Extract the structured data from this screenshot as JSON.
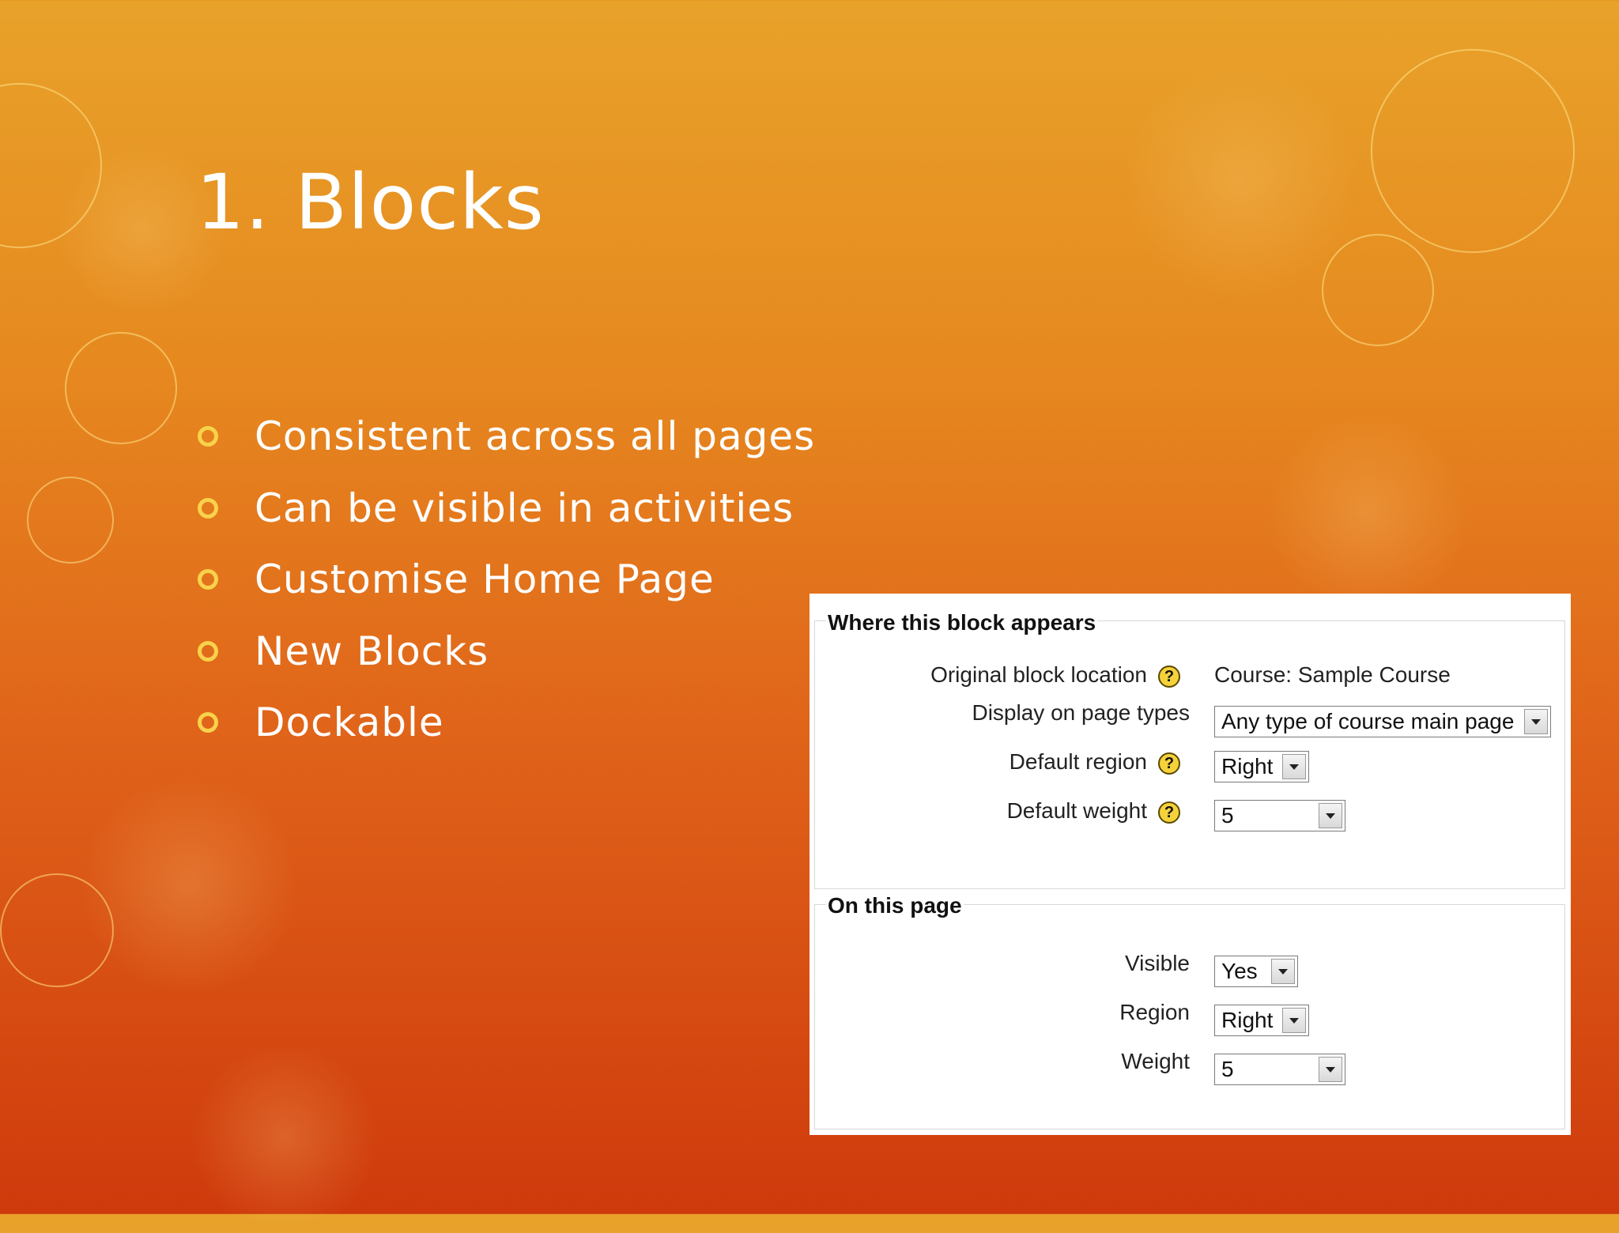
{
  "slide": {
    "title": "1. Blocks",
    "bullets": [
      "Consistent across all pages",
      "Can be visible in activities",
      "Customise Home Page",
      "New Blocks",
      "Dockable"
    ]
  },
  "panel": {
    "section1": {
      "legend": "Where this block appears",
      "original_location_label": "Original block location",
      "original_location_value": "Course: Sample Course",
      "page_types_label": "Display on page types",
      "page_types_value": "Any type of course main page",
      "default_region_label": "Default region",
      "default_region_value": "Right",
      "default_weight_label": "Default weight",
      "default_weight_value": "5"
    },
    "section2": {
      "legend": "On this page",
      "visible_label": "Visible",
      "visible_value": "Yes",
      "region_label": "Region",
      "region_value": "Right",
      "weight_label": "Weight",
      "weight_value": "5"
    },
    "help_glyph": "?"
  },
  "icons": {
    "bullet": "ring-bullet-icon",
    "help": "help-icon",
    "dropdown": "chevron-down-icon"
  },
  "colors": {
    "bullet": "#f7d24a",
    "help": "#f5d23a"
  }
}
